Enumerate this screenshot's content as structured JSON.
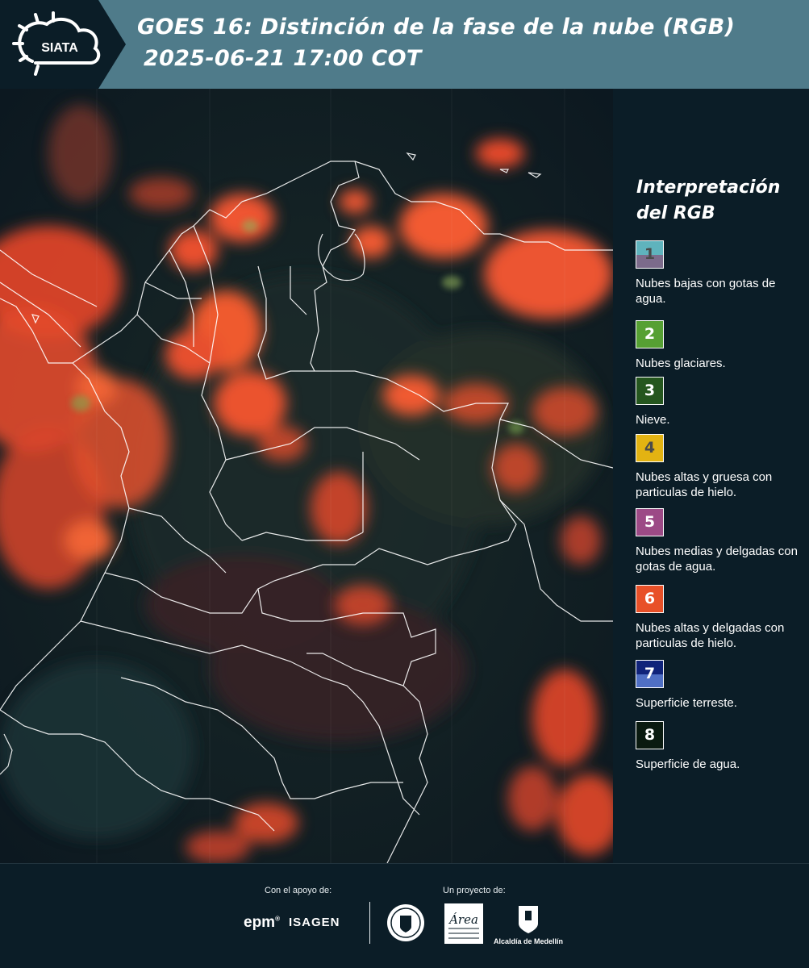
{
  "header": {
    "logo_text": "SIATA",
    "title": "GOES 16: Distinción de la fase de la nube (RGB)",
    "subtitle": "2025-06-21 17:00 COT"
  },
  "legend": {
    "title": "Interpretación del RGB",
    "items": [
      {
        "number": "1",
        "label": "Nubes bajas con gotas de agua.",
        "colors": [
          "#5fb3bd",
          "#7c6b8b"
        ],
        "num_color": "#4a4a4a"
      },
      {
        "number": "2",
        "label": "Nubes glaciares.",
        "colors": [
          "#56a033",
          "#56a033"
        ],
        "num_color": "#ffffff"
      },
      {
        "number": "3",
        "label": "Nieve.",
        "colors": [
          "#25561e",
          "#25561e"
        ],
        "num_color": "#ffffff"
      },
      {
        "number": "4",
        "label": "Nubes altas y gruesa con particulas de hielo.",
        "colors": [
          "#e3b312",
          "#e3b312"
        ],
        "num_color": "#4a4a4a"
      },
      {
        "number": "5",
        "label": "Nubes medias y delgadas con gotas de agua.",
        "colors": [
          "#9c4a86",
          "#9c4a86"
        ],
        "num_color": "#ffffff"
      },
      {
        "number": "6",
        "label": "Nubes altas y delgadas con particulas de hielo.",
        "colors": [
          "#e85028",
          "#e85028"
        ],
        "num_color": "#ffffff"
      },
      {
        "number": "7",
        "label": "Superficie terreste.",
        "colors": [
          "#10237a",
          "#4f6fc4"
        ],
        "num_color": "#ffffff"
      },
      {
        "number": "8",
        "label": "Superficie de agua.",
        "colors": [
          "#0a1a10",
          "#0a1a10"
        ],
        "num_color": "#ffffff"
      }
    ]
  },
  "footer": {
    "support_label": "Con el apoyo de:",
    "project_label": "Un proyecto de:",
    "epm": "epm",
    "isagen": "ISAGEN",
    "area_metropolitana": "Área",
    "alcaldia": "Alcaldía de Medellín"
  }
}
